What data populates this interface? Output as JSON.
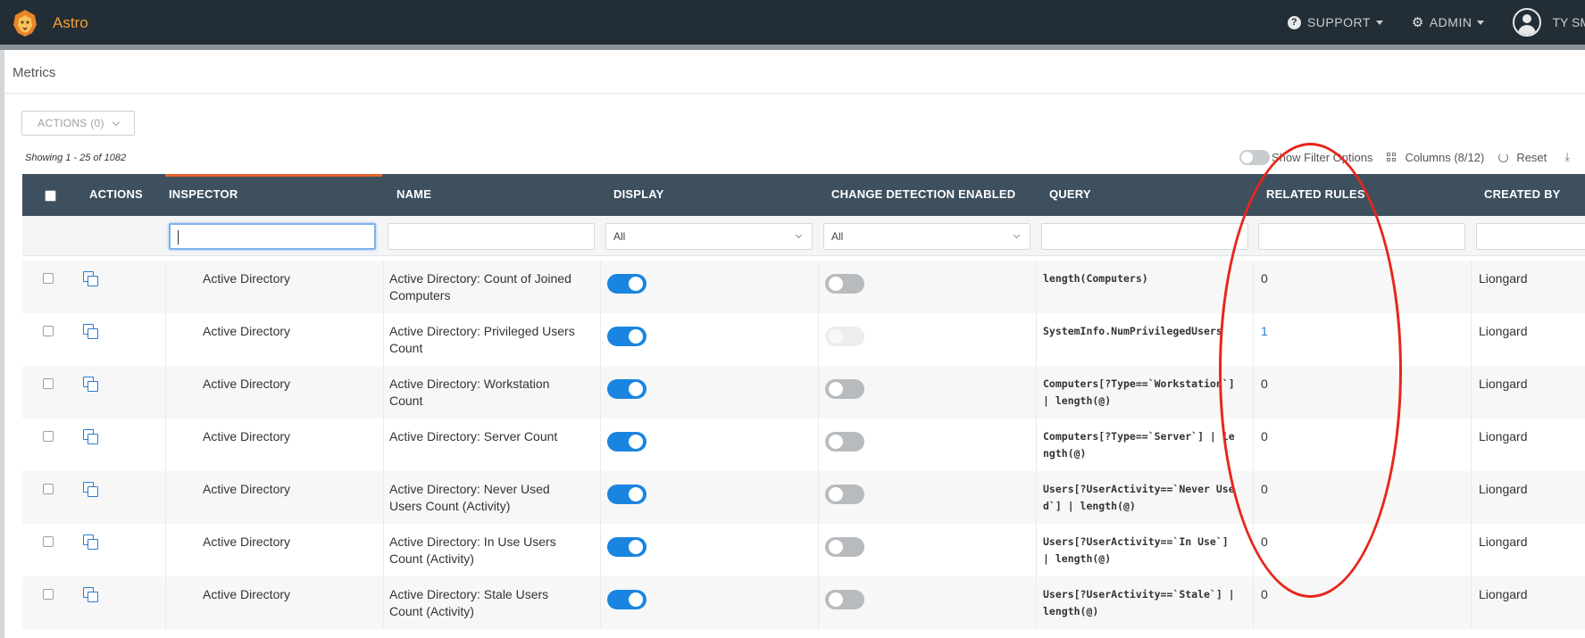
{
  "app": {
    "brand": "Astro",
    "nav": {
      "support_label": "SUPPORT",
      "admin_label": "ADMIN",
      "user_label": "TY SM"
    }
  },
  "page": {
    "title": "Metrics",
    "actions_button": "ACTIONS (0)",
    "showing": "Showing 1 - 25 of 1082",
    "toolbar": {
      "show_filter": "Show Filter Options",
      "columns": "Columns (8/12)",
      "reset": "Reset"
    }
  },
  "table": {
    "headers": [
      "ACTIONS",
      "INSPECTOR",
      "NAME",
      "DISPLAY",
      "CHANGE DETECTION ENABLED",
      "QUERY",
      "RELATED RULES",
      "CREATED BY"
    ],
    "filters": {
      "display_select": "All",
      "change_select": "All"
    },
    "rows": [
      {
        "inspector": "Active Directory",
        "name": "Active Directory: Count of Joined Computers",
        "display": true,
        "change": "off",
        "query": "length(Computers)",
        "related": "0",
        "created_by": "Liongard"
      },
      {
        "inspector": "Active Directory",
        "name": "Active Directory: Privileged Users Count",
        "display": true,
        "change": "disabled",
        "query": "SystemInfo.NumPrivilegedUsers",
        "related": "1",
        "created_by": "Liongard"
      },
      {
        "inspector": "Active Directory",
        "name": "Active Directory: Workstation Count",
        "display": true,
        "change": "off",
        "query": "Computers[?Type==`Workstation`] | length(@)",
        "related": "0",
        "created_by": "Liongard"
      },
      {
        "inspector": "Active Directory",
        "name": "Active Directory: Server Count",
        "display": true,
        "change": "off",
        "query": "Computers[?Type==`Server`] | length(@)",
        "related": "0",
        "created_by": "Liongard"
      },
      {
        "inspector": "Active Directory",
        "name": "Active Directory: Never Used Users Count (Activity)",
        "display": true,
        "change": "off",
        "query": "Users[?UserActivity==`Never Used`] | length(@)",
        "related": "0",
        "created_by": "Liongard"
      },
      {
        "inspector": "Active Directory",
        "name": "Active Directory: In Use Users Count (Activity)",
        "display": true,
        "change": "off",
        "query": "Users[?UserActivity==`In Use`] | length(@)",
        "related": "0",
        "created_by": "Liongard"
      },
      {
        "inspector": "Active Directory",
        "name": "Active Directory: Stale Users Count (Activity)",
        "display": true,
        "change": "off",
        "query": "Users[?UserActivity==`Stale`] | length(@)",
        "related": "0",
        "created_by": "Liongard"
      }
    ]
  },
  "colors": {
    "nav_bg": "#222d35",
    "header_bg": "#3e4f5e",
    "accent": "#1a85e0",
    "active_tab": "#e8622e",
    "annotation": "#e8261b"
  }
}
